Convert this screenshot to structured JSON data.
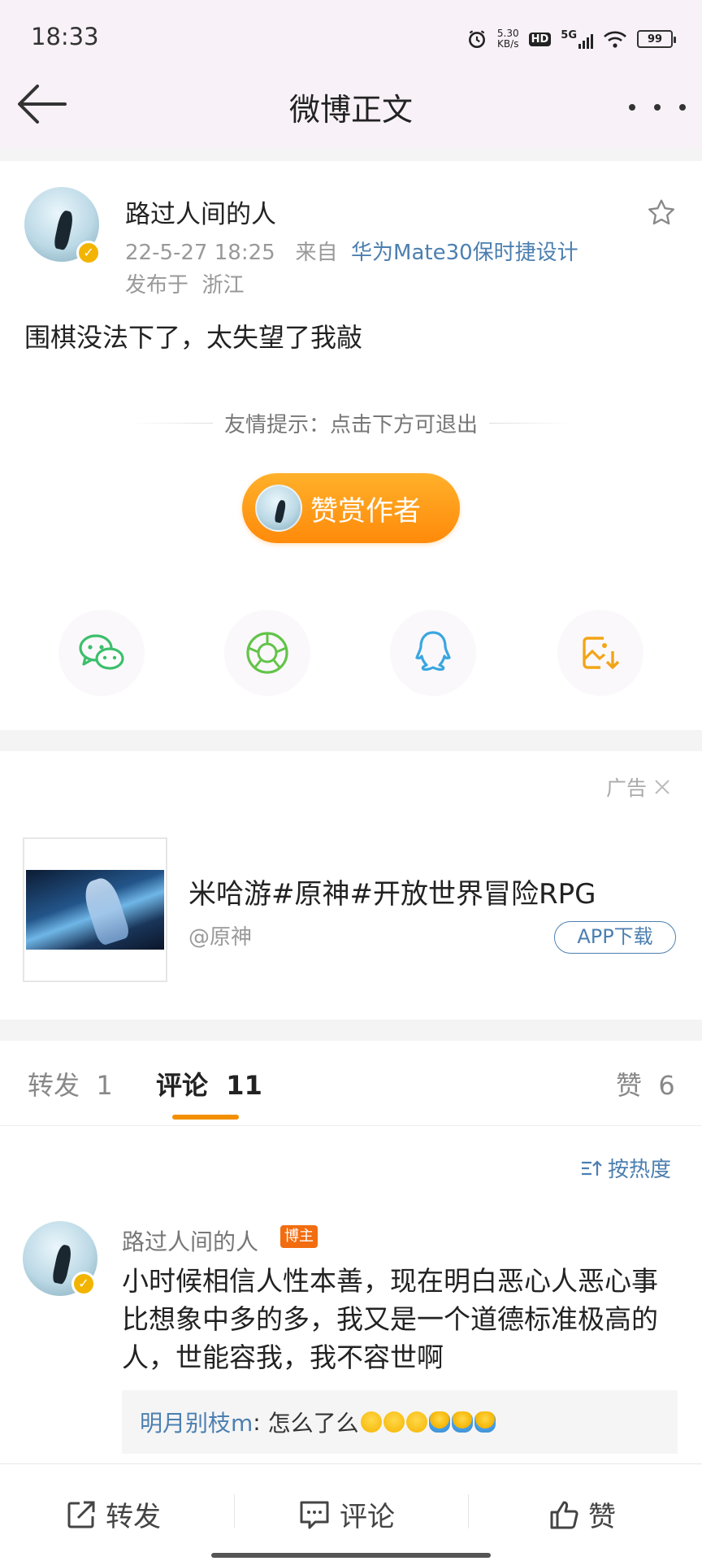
{
  "status_bar": {
    "time": "18:33",
    "net_speed_value": "5.30",
    "net_speed_unit": "KB/s",
    "hd": "HD",
    "signal": "5G",
    "battery": "99"
  },
  "header": {
    "title": "微博正文"
  },
  "post": {
    "author": "路过人间的人",
    "date": "22-5-27  18:25",
    "source_prefix": "来自",
    "source": "华为Mate30保时捷设计",
    "location_prefix": "发布于",
    "location": "浙江",
    "text": "围棋没法下了，太失望了我敲",
    "tip": "友情提示：点击下方可退出",
    "reward_label": "赞赏作者"
  },
  "share_icons": [
    "wechat-icon",
    "moments-icon",
    "qq-icon",
    "save-image-icon"
  ],
  "ad": {
    "label": "广告",
    "title": "米哈游#原神#开放世界冒险RPG",
    "handle": "@原神",
    "button": "APP下载"
  },
  "tabs": {
    "repost_label": "转发",
    "repost_count": "1",
    "comment_label": "评论",
    "comment_count": "11",
    "like_label": "赞",
    "like_count": "6"
  },
  "sort_label": "按热度",
  "comment": {
    "author": "路过人间的人",
    "badge": "博主",
    "text": "小时候相信人性本善，现在明白恶心人恶心事比想象中多的多，我又是一个道德标准极高的人，世能容我，我不容世啊",
    "reply_author": "明月别枝m",
    "reply_sep": ":",
    "reply_text": "怎么了么"
  },
  "bottom_bar": {
    "repost": "转发",
    "comment": "评论",
    "like": "赞"
  },
  "colors": {
    "accent_orange": "#f29000",
    "link_blue": "#4c7fb0",
    "header_bg": "#f8f2f8"
  }
}
